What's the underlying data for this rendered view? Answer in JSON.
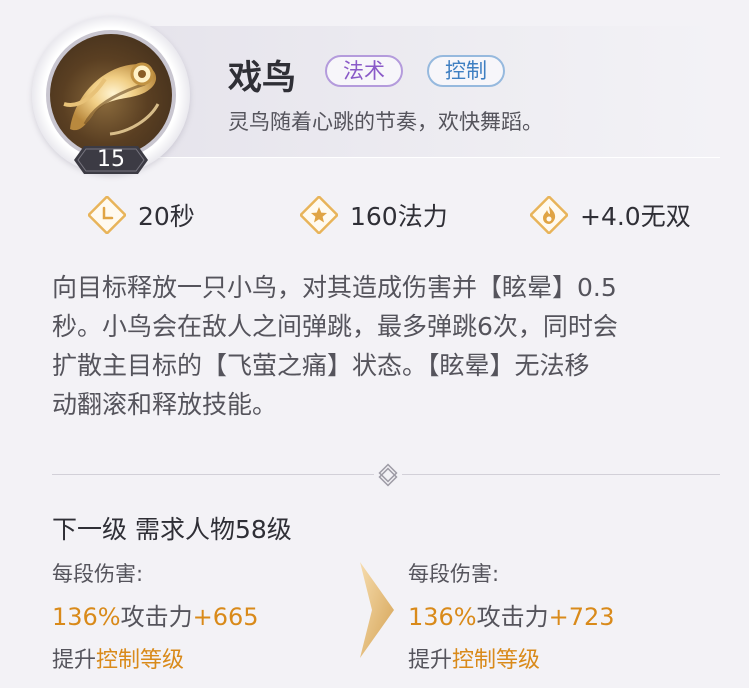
{
  "skill": {
    "name": "戏鸟",
    "level": "15",
    "tags": [
      "法术",
      "控制"
    ],
    "flavor": "灵鸟随着心跳的节奏，欢快舞蹈。",
    "icon": "golden-bird-swirl-icon"
  },
  "stats": {
    "cooldown": "20秒",
    "cost": "160法力",
    "musou": "+4.0无双"
  },
  "description": [
    "向目标释放一只小鸟，对其造成伤害并【眩晕】0.5",
    "秒。小鸟会在敌人之间弹跳，最多弹跳6次，同时会",
    "扩散主目标的【飞萤之痛】状态。【眩晕】无法移",
    "动翻滚和释放技能。"
  ],
  "next_level": {
    "title": "下一级 需求人物58级",
    "current": {
      "label": "每段伤害:",
      "value_pct": "136%",
      "value_mid": "攻击力",
      "value_add": "+665",
      "upgrade_prefix": "提升",
      "upgrade_highlight": "控制等级"
    },
    "next": {
      "label": "每段伤害:",
      "value_pct": "136%",
      "value_mid": "攻击力",
      "value_add": "+723",
      "upgrade_prefix": "提升",
      "upgrade_highlight": "控制等级"
    }
  },
  "colors": {
    "accent_gold": "#d98a1a",
    "tag_magic": "#8a5ac8",
    "tag_control": "#3f7fc2",
    "diamond_gold": "#e8b45a"
  }
}
